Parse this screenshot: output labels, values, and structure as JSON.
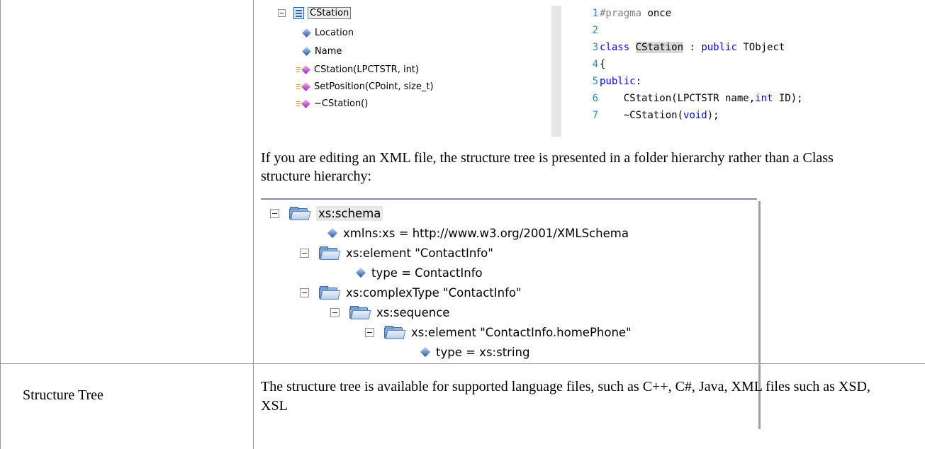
{
  "class_tree": {
    "root": "CStation",
    "members": [
      "Location",
      "Name"
    ],
    "methods": [
      "CStation(LPCTSTR, int)",
      "SetPosition(CPoint, size_t)",
      "~CStation()"
    ]
  },
  "code": {
    "line_numbers": [
      "1",
      "2",
      "3",
      "4",
      "5",
      "6",
      "7"
    ],
    "l1_directive": "#pragma",
    "l1_rest": " once",
    "l3_kw": "class",
    "l3_name": "CStation",
    "l3_mid": " : ",
    "l3_kw2": "public",
    "l3_rest": " TObject",
    "l4": "{",
    "l5_kw": "public",
    "l5_rest": ":",
    "l6_a": "    CStation(LPCTSTR name,",
    "l6_kw": "int",
    "l6_b": " ID);",
    "l7_a": "    ~CStation(",
    "l7_kw": "void",
    "l7_b": ");"
  },
  "paragraph": "If you are editing an XML file, the structure tree is presented in a folder hierarchy rather than a Class structure hierarchy:",
  "xml_tree": {
    "schema": "xs:schema",
    "xmlns": "xmlns:xs = http://www.w3.org/2001/XMLSchema",
    "element": "xs:element \"ContactInfo\"",
    "element_type": "type = ContactInfo",
    "complex": "xs:complexType \"ContactInfo\"",
    "sequence": "xs:sequence",
    "home_phone": "xs:element \"ContactInfo.homePhone\"",
    "home_phone_type": "type = xs:string"
  },
  "row2": {
    "term": "Structure Tree",
    "description": "The structure tree is available for supported language files, such as C++, C#, Java, XML files such as XSD, XSL"
  }
}
